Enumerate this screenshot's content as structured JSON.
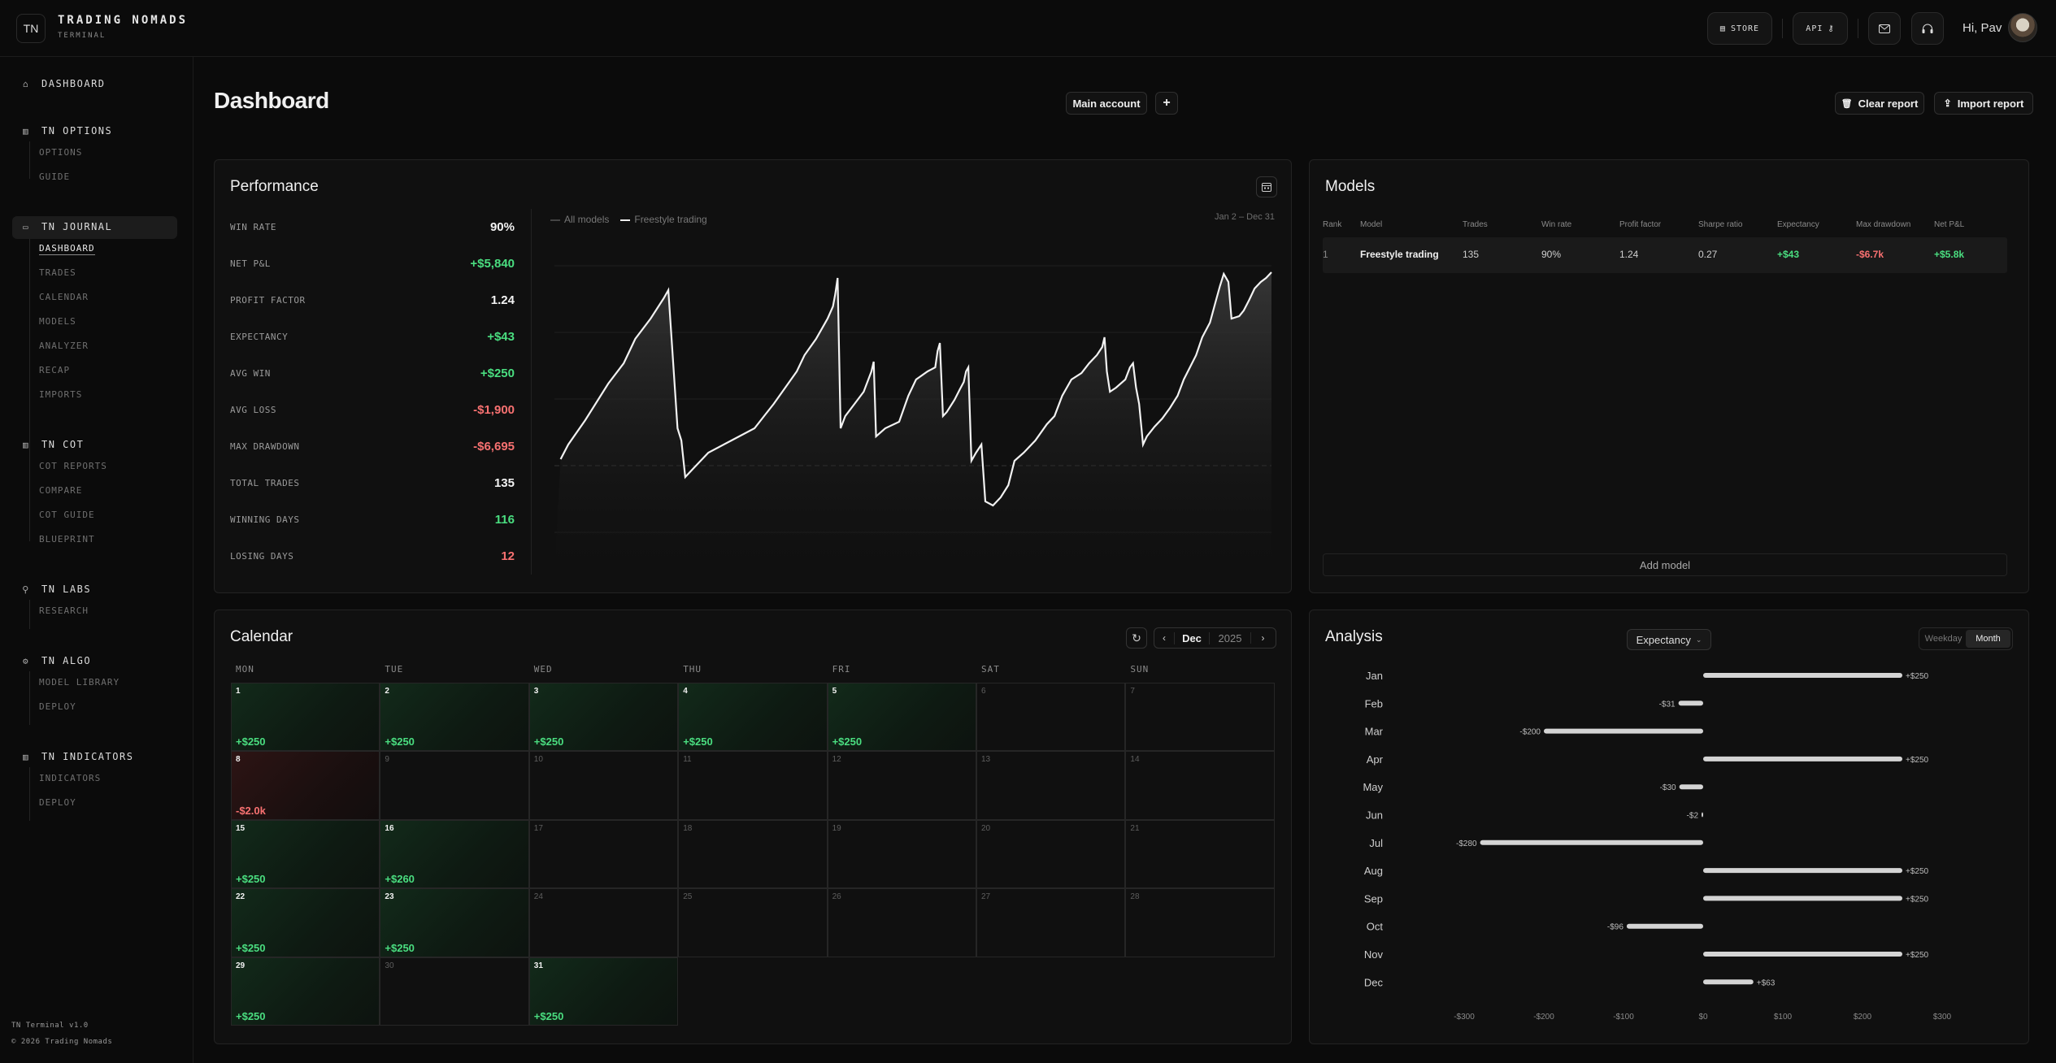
{
  "brand": {
    "logo": "TN",
    "name": "TRADING NOMADS",
    "sub": "TERMINAL"
  },
  "topbar": {
    "store": "STORE",
    "api": "API",
    "greeting": "Hi, Pav"
  },
  "sidebar": {
    "dashboard": "DASHBOARD",
    "options": {
      "title": "TN OPTIONS",
      "items": [
        "OPTIONS",
        "GUIDE"
      ]
    },
    "journal": {
      "title": "TN JOURNAL",
      "items": [
        "DASHBOARD",
        "TRADES",
        "CALENDAR",
        "MODELS",
        "ANALYZER",
        "RECAP",
        "IMPORTS"
      ]
    },
    "cot": {
      "title": "TN COT",
      "items": [
        "COT REPORTS",
        "COMPARE",
        "COT GUIDE",
        "BLUEPRINT"
      ]
    },
    "labs": {
      "title": "TN LABS",
      "items": [
        "RESEARCH"
      ]
    },
    "algo": {
      "title": "TN ALGO",
      "items": [
        "MODEL LIBRARY",
        "DEPLOY"
      ]
    },
    "indicators": {
      "title": "TN INDICATORS",
      "items": [
        "INDICATORS",
        "DEPLOY"
      ]
    },
    "footer": {
      "version": "TN Terminal v1.0",
      "copyright": "© 2026 Trading Nomads"
    }
  },
  "page": {
    "title": "Dashboard",
    "account": "Main account",
    "add": "+",
    "clear": "Clear report",
    "import": "Import report"
  },
  "performance": {
    "title": "Performance",
    "legend": [
      "All models",
      "Freestyle trading"
    ],
    "range": "Jan 2 – Dec 31",
    "stats": [
      {
        "label": "WIN RATE",
        "value": "90%",
        "tone": "white"
      },
      {
        "label": "NET P&L",
        "value": "+$5,840",
        "tone": "green"
      },
      {
        "label": "PROFIT FACTOR",
        "value": "1.24",
        "tone": "white"
      },
      {
        "label": "EXPECTANCY",
        "value": "+$43",
        "tone": "green"
      },
      {
        "label": "AVG WIN",
        "value": "+$250",
        "tone": "green"
      },
      {
        "label": "AVG LOSS",
        "value": "-$1,900",
        "tone": "red"
      },
      {
        "label": "MAX DRAWDOWN",
        "value": "-$6,695",
        "tone": "red"
      },
      {
        "label": "TOTAL TRADES",
        "value": "135",
        "tone": "white"
      },
      {
        "label": "WINNING DAYS",
        "value": "116",
        "tone": "green"
      },
      {
        "label": "LOSING DAYS",
        "value": "12",
        "tone": "red"
      }
    ]
  },
  "models": {
    "title": "Models",
    "columns": [
      "Rank",
      "Model",
      "Trades",
      "Win rate",
      "Profit factor",
      "Sharpe ratio",
      "Expectancy",
      "Max drawdown",
      "Net P&L"
    ],
    "rows": [
      [
        "1",
        "Freestyle trading",
        "135",
        "90%",
        "1.24",
        "0.27",
        "+$43",
        "-$6.7k",
        "+$5.8k"
      ]
    ],
    "add": "Add model"
  },
  "calendar": {
    "title": "Calendar",
    "month": "Dec",
    "year": "2025",
    "days": [
      "MON",
      "TUE",
      "WED",
      "THU",
      "FRI",
      "SAT",
      "SUN"
    ],
    "cells": [
      {
        "d": "1",
        "v": "+$250",
        "t": "pos"
      },
      {
        "d": "2",
        "v": "+$250",
        "t": "pos"
      },
      {
        "d": "3",
        "v": "+$250",
        "t": "pos"
      },
      {
        "d": "4",
        "v": "+$250",
        "t": "pos"
      },
      {
        "d": "5",
        "v": "+$250",
        "t": "pos"
      },
      {
        "d": "6",
        "v": "",
        "t": ""
      },
      {
        "d": "7",
        "v": "",
        "t": ""
      },
      {
        "d": "8",
        "v": "-$2.0k",
        "t": "neg"
      },
      {
        "d": "9",
        "v": "",
        "t": ""
      },
      {
        "d": "10",
        "v": "",
        "t": ""
      },
      {
        "d": "11",
        "v": "",
        "t": ""
      },
      {
        "d": "12",
        "v": "",
        "t": ""
      },
      {
        "d": "13",
        "v": "",
        "t": ""
      },
      {
        "d": "14",
        "v": "",
        "t": ""
      },
      {
        "d": "15",
        "v": "+$250",
        "t": "pos"
      },
      {
        "d": "16",
        "v": "+$260",
        "t": "pos"
      },
      {
        "d": "17",
        "v": "",
        "t": ""
      },
      {
        "d": "18",
        "v": "",
        "t": ""
      },
      {
        "d": "19",
        "v": "",
        "t": ""
      },
      {
        "d": "20",
        "v": "",
        "t": ""
      },
      {
        "d": "21",
        "v": "",
        "t": ""
      },
      {
        "d": "22",
        "v": "+$250",
        "t": "pos"
      },
      {
        "d": "23",
        "v": "+$250",
        "t": "pos"
      },
      {
        "d": "24",
        "v": "",
        "t": ""
      },
      {
        "d": "25",
        "v": "",
        "t": ""
      },
      {
        "d": "26",
        "v": "",
        "t": ""
      },
      {
        "d": "27",
        "v": "",
        "t": ""
      },
      {
        "d": "28",
        "v": "",
        "t": ""
      },
      {
        "d": "29",
        "v": "+$250",
        "t": "pos"
      },
      {
        "d": "30",
        "v": "",
        "t": ""
      },
      {
        "d": "31",
        "v": "+$250",
        "t": "pos"
      }
    ]
  },
  "analysis": {
    "title": "Analysis",
    "metric": "Expectancy",
    "toggle": [
      "Weekday",
      "Month"
    ],
    "months": [
      "Jan",
      "Feb",
      "Mar",
      "Apr",
      "May",
      "Jun",
      "Jul",
      "Aug",
      "Sep",
      "Oct",
      "Nov",
      "Dec"
    ],
    "values": [
      250,
      -31,
      -200,
      250,
      -30,
      -2,
      -280,
      250,
      250,
      -96,
      250,
      63
    ],
    "labels": [
      "+$250",
      "-$31",
      "-$200",
      "+$250",
      "-$30",
      "-$2",
      "-$280",
      "+$250",
      "+$250",
      "-$96",
      "+$250",
      "+$63"
    ],
    "ticks": [
      "-$300",
      "-$200",
      "-$100",
      "$0",
      "$100",
      "$200",
      "$300"
    ]
  },
  "colors": {
    "green": "#4ade80",
    "red": "#f87171",
    "bg": "#0b0b0b",
    "panel": "#101010"
  }
}
